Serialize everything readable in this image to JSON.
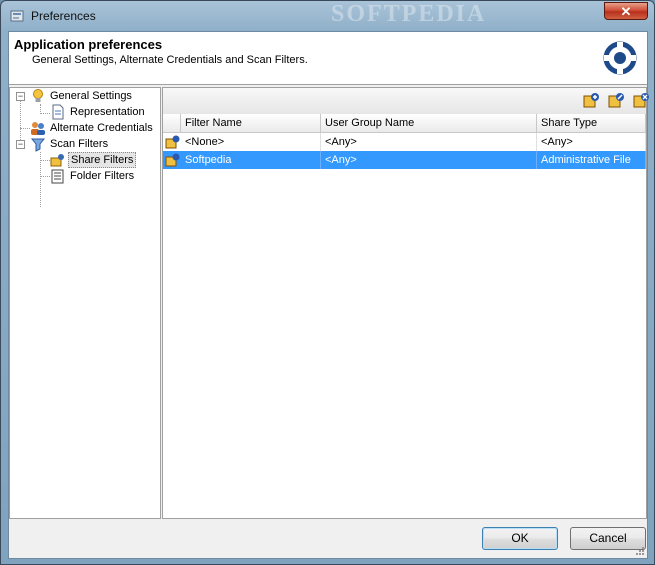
{
  "window": {
    "title": "Preferences",
    "watermark": "SOFTPEDIA",
    "close_label": "✕"
  },
  "header": {
    "title": "Application preferences",
    "subtitle": "General Settings, Alternate Credentials and Scan Filters."
  },
  "tree": {
    "items": [
      {
        "label": "General Settings",
        "icon": "lightbulb-icon",
        "expanded": true
      },
      {
        "label": "Representation",
        "icon": "document-icon"
      },
      {
        "label": "Alternate Credentials",
        "icon": "users-icon"
      },
      {
        "label": "Scan Filters",
        "icon": "filter-icon",
        "expanded": true
      },
      {
        "label": "Share Filters",
        "icon": "share-filter-icon",
        "selected": true
      },
      {
        "label": "Folder Filters",
        "icon": "folder-filter-icon"
      }
    ]
  },
  "grid": {
    "columns": [
      "Filter Name",
      "User Group Name",
      "Share Type"
    ],
    "rows": [
      {
        "filter_name": "<None>",
        "user_group": "<Any>",
        "share_type": "<Any>",
        "selected": false
      },
      {
        "filter_name": "Softpedia",
        "user_group": "<Any>",
        "share_type": "Administrative File",
        "selected": true
      }
    ]
  },
  "toolbar": {
    "add_icon": "add-filter-icon",
    "edit_icon": "edit-filter-icon",
    "delete_icon": "delete-filter-icon"
  },
  "buttons": {
    "ok": "OK",
    "cancel": "Cancel"
  },
  "colors": {
    "selection": "#3399ff",
    "window_frame": "#8fb0c9",
    "close": "#c8402a"
  }
}
